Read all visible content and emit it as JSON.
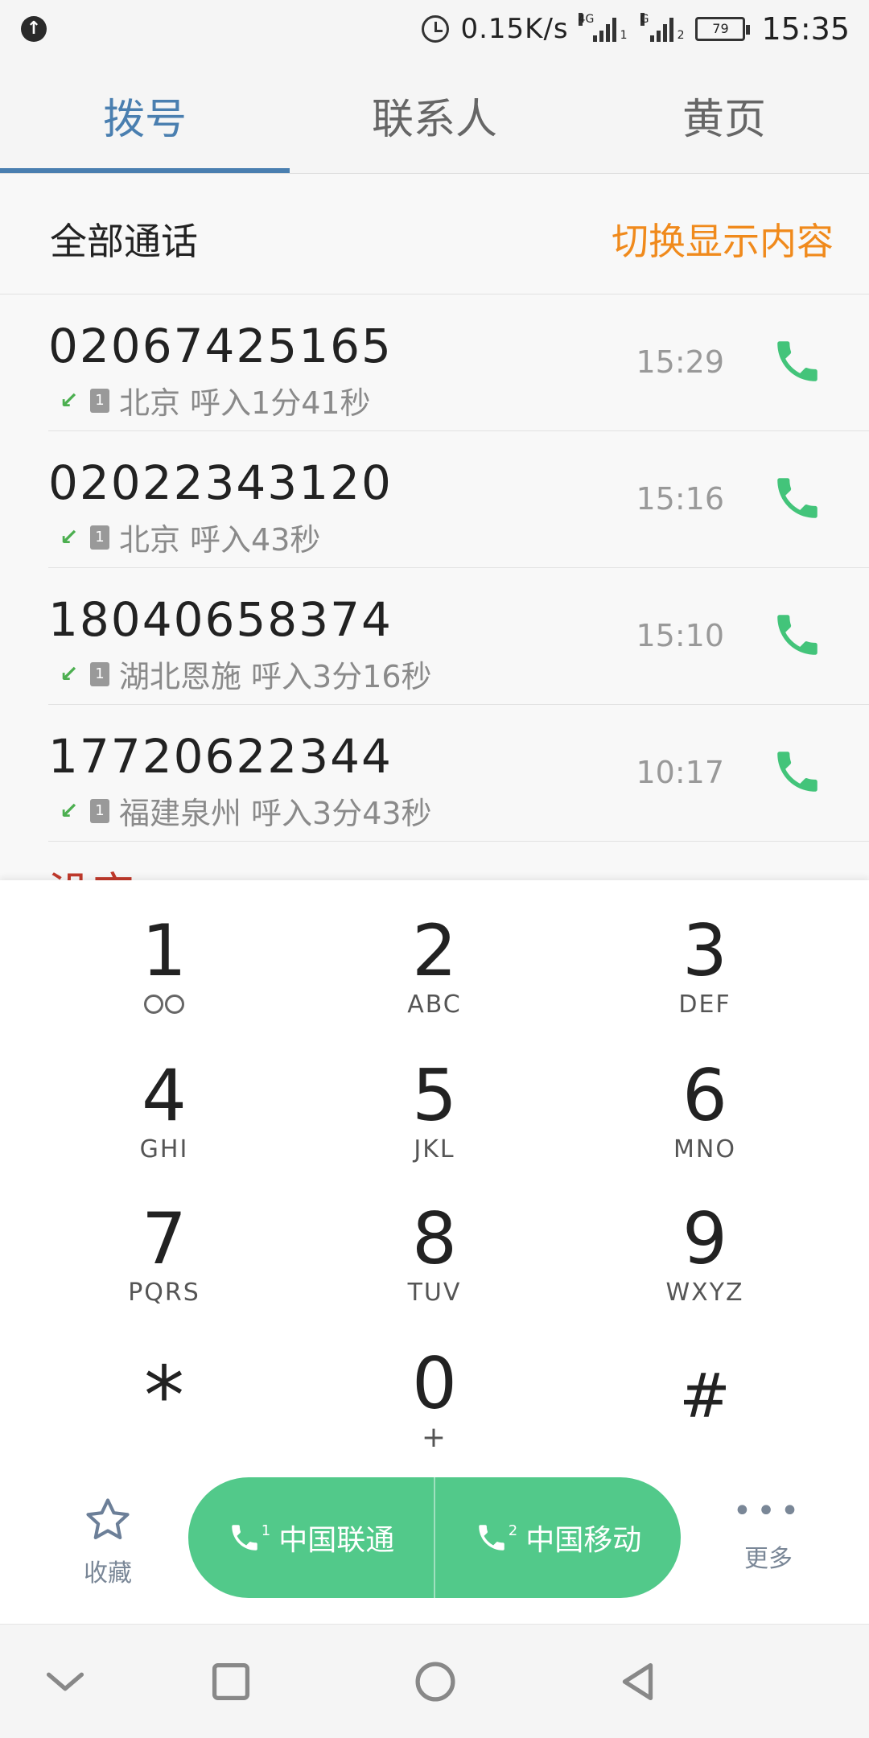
{
  "status_bar": {
    "net_speed": "0.15K/s",
    "sim1_network": "4G",
    "sim1_index": "1",
    "sim2_network": "G",
    "sim2_index": "2",
    "battery": "79",
    "time": "15:35"
  },
  "tabs": [
    {
      "label": "拨号",
      "active": true
    },
    {
      "label": "联系人",
      "active": false
    },
    {
      "label": "黄页",
      "active": false
    }
  ],
  "filter": {
    "title": "全部通话",
    "toggle_label": "切换显示内容"
  },
  "calls": [
    {
      "number": "02067425165",
      "sim": "1",
      "location": "北京",
      "detail": "呼入1分41秒",
      "time": "15:29"
    },
    {
      "number": "02022343120",
      "sim": "1",
      "location": "北京",
      "detail": "呼入43秒",
      "time": "15:16"
    },
    {
      "number": "18040658374",
      "sim": "1",
      "location": "湖北恩施",
      "detail": "呼入3分16秒",
      "time": "15:10"
    },
    {
      "number": "17720622344",
      "sim": "1",
      "location": "福建泉州",
      "detail": "呼入3分43秒",
      "time": "10:17"
    }
  ],
  "peek_text": "没宝",
  "keypad": [
    {
      "digit": "1",
      "letters": ""
    },
    {
      "digit": "2",
      "letters": "ABC"
    },
    {
      "digit": "3",
      "letters": "DEF"
    },
    {
      "digit": "4",
      "letters": "GHI"
    },
    {
      "digit": "5",
      "letters": "JKL"
    },
    {
      "digit": "6",
      "letters": "MNO"
    },
    {
      "digit": "7",
      "letters": "PQRS"
    },
    {
      "digit": "8",
      "letters": "TUV"
    },
    {
      "digit": "9",
      "letters": "WXYZ"
    },
    {
      "digit": "*",
      "letters": ""
    },
    {
      "digit": "0",
      "letters": "+"
    },
    {
      "digit": "#",
      "letters": ""
    }
  ],
  "actions": {
    "favorites_label": "收藏",
    "sim1_label": "中国联通",
    "sim1_index": "1",
    "sim2_label": "中国移动",
    "sim2_index": "2",
    "more_label": "更多"
  },
  "colors": {
    "accent": "#4a7fb0",
    "toggle": "#f08a1c",
    "call_green": "#52c98a"
  }
}
